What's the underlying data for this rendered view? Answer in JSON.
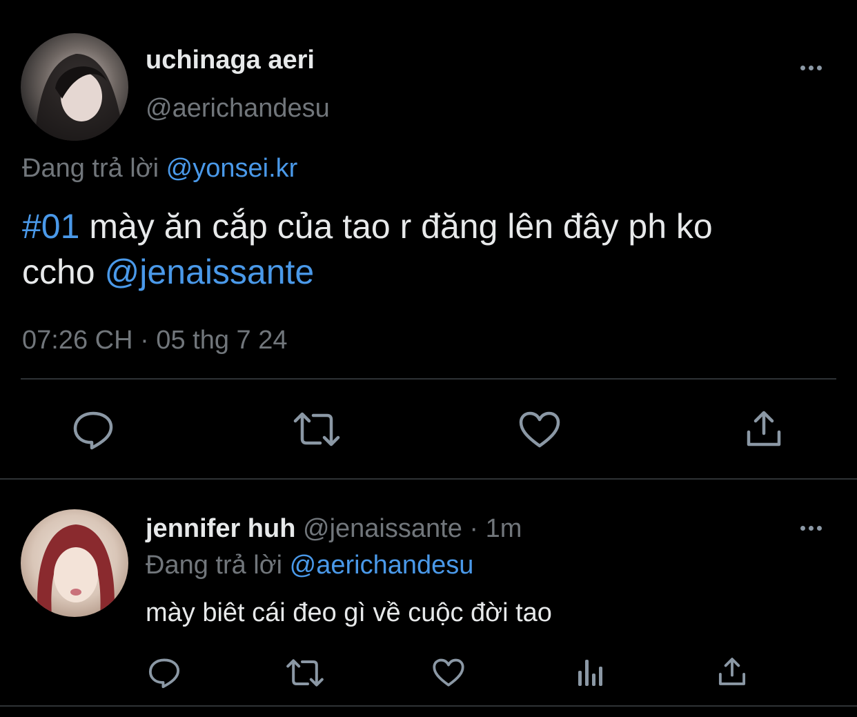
{
  "main_tweet": {
    "display_name": "uchinaga aeri",
    "handle": "@aerichandesu",
    "replying_prefix": "Đang trả lời",
    "replying_to": "@yonsei.kr",
    "text_hashtag": "#01",
    "text_body": "mày ăn cắp của tao r đăng lên đây ph ko",
    "text_line2": "ccho",
    "text_mention": "@jenaissante",
    "timestamp": "07:26 CH · 05 thg 7 24",
    "actions": [
      "reply-icon",
      "retweet-icon",
      "like-icon",
      "share-icon"
    ]
  },
  "reply_tweet": {
    "display_name": "jennifer huh",
    "handle": "@jenaissante",
    "separator": "·",
    "time_ago": "1m",
    "replying_prefix": "Đang trả lời",
    "replying_to": "@aerichandesu",
    "text": "mày biêt cái đeo gì về cuộc đời tao",
    "actions": [
      "reply-icon",
      "retweet-icon",
      "like-icon",
      "analytics-icon",
      "share-icon"
    ]
  },
  "colors": {
    "background": "#000000",
    "text": "#e7e9ea",
    "muted": "#71767b",
    "link": "#4a99e9",
    "divider": "#2f3336"
  }
}
